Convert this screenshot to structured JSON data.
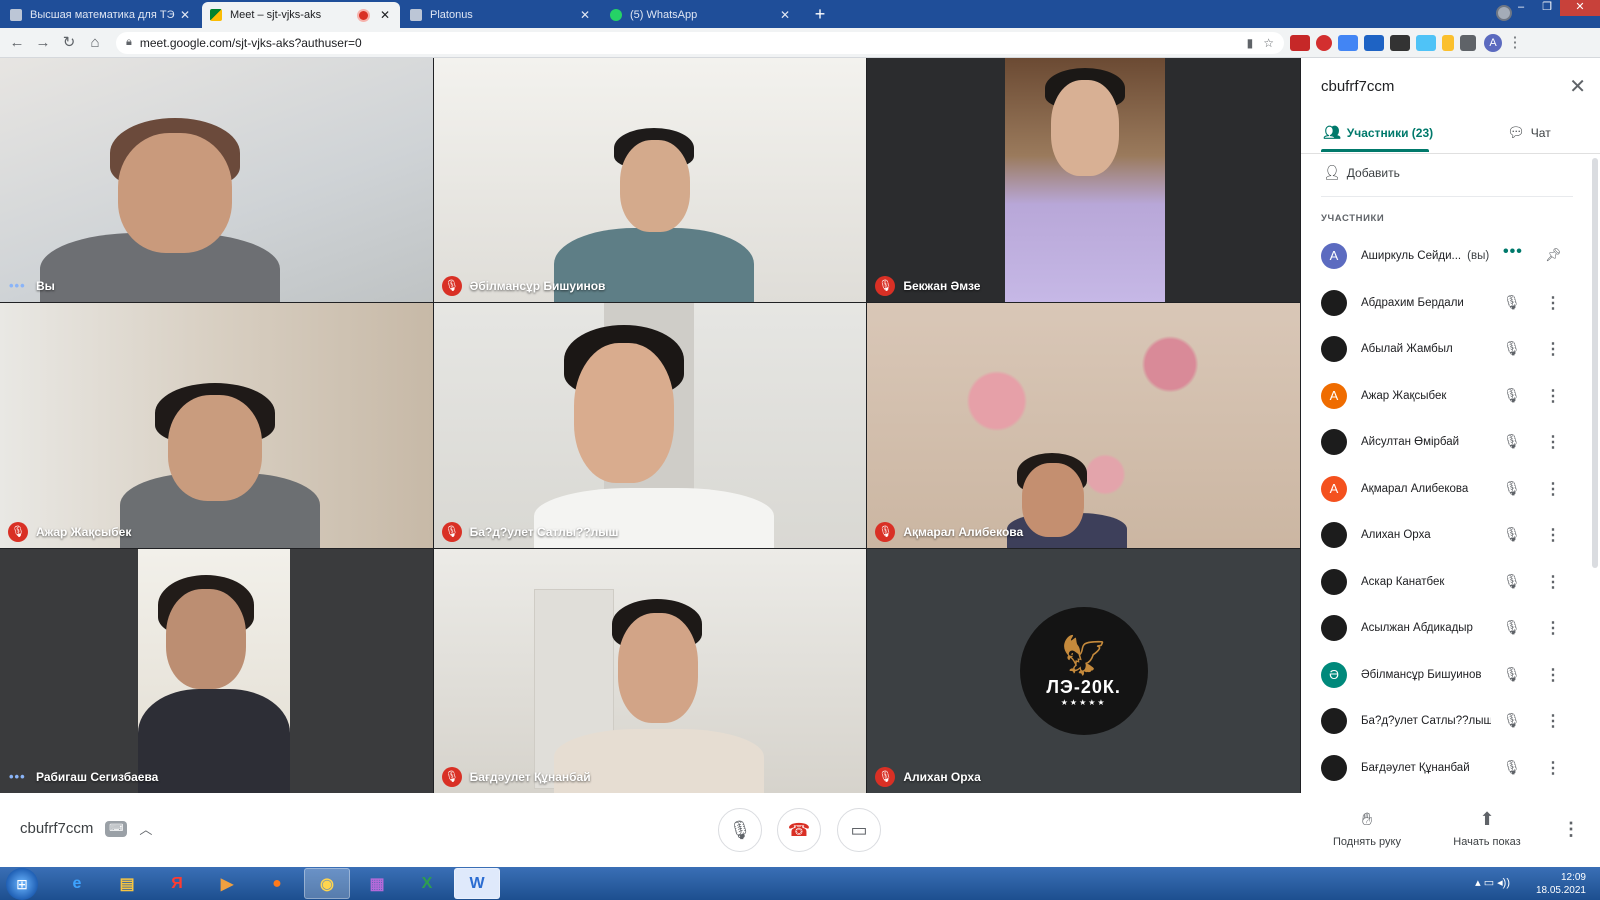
{
  "browser": {
    "tabs": [
      {
        "title": "Высшая математика для ТЭ",
        "active": false
      },
      {
        "title": "Meet – sjt-vjks-aks",
        "active": true,
        "recording": true
      },
      {
        "title": "Platonus",
        "active": false
      },
      {
        "title": "(5) WhatsApp",
        "active": false
      }
    ],
    "new_tab": "+",
    "url": "meet.google.com/sjt-vjks-aks?authuser=0",
    "profile_initial": "A"
  },
  "tiles": [
    {
      "name": "Вы",
      "indicator": "dots"
    },
    {
      "name": "Әбілмансұр Бишуинов",
      "indicator": "muted"
    },
    {
      "name": "Бекжан Әмзе",
      "indicator": "muted"
    },
    {
      "name": "Ажар Жақсыбек",
      "indicator": "muted"
    },
    {
      "name": "Ба?д?улет Сатлы??лыш",
      "indicator": "muted"
    },
    {
      "name": "Ақмарал Алибекова",
      "indicator": "muted"
    },
    {
      "name": "Рабигаш Сегизбаева",
      "indicator": "dots"
    },
    {
      "name": "Бағдәулет Құнанбай",
      "indicator": "muted"
    },
    {
      "name": "Алихан Орха",
      "indicator": "muted"
    }
  ],
  "logo": {
    "text": "ЛЭ-20К.",
    "stars": "★★★★★"
  },
  "panel": {
    "title": "cbufrf7ccm",
    "tab_people": "Участники (23)",
    "tab_chat": "Чат",
    "add_label": "Добавить",
    "section_label": "Участники",
    "you_suffix": "(вы)",
    "participants": [
      {
        "name": "Аширкуль Сейди...",
        "avatar": "A",
        "color": "#5c6bc0",
        "you": true
      },
      {
        "name": "Абдрахим Бердали",
        "avatar": "",
        "color": "#1c1c1c"
      },
      {
        "name": "Абылай Жамбыл",
        "avatar": "",
        "color": "#1c1c1c"
      },
      {
        "name": "Ажар Жақсыбек",
        "avatar": "A",
        "color": "#ef6c00"
      },
      {
        "name": "Айсултан Өмірбай",
        "avatar": "",
        "color": "#1c1c1c"
      },
      {
        "name": "Ақмарал Алибекова",
        "avatar": "A",
        "color": "#f4511e"
      },
      {
        "name": "Алихан Орха",
        "avatar": "",
        "color": "#1c1c1c"
      },
      {
        "name": "Аскар Канатбек",
        "avatar": "",
        "color": "#1c1c1c"
      },
      {
        "name": "Асылжан Абдикадыр",
        "avatar": "",
        "color": "#1c1c1c"
      },
      {
        "name": "Әбілмансұр Бишуинов",
        "avatar": "Ә",
        "color": "#00897b"
      },
      {
        "name": "Ба?д?улет Сатлы??лыш",
        "avatar": "",
        "color": "#1c1c1c"
      },
      {
        "name": "Бағдәулет Құнанбай",
        "avatar": "",
        "color": "#1c1c1c"
      }
    ]
  },
  "bottom": {
    "meeting_code": "cbufrf7ccm",
    "raise_hand": "Поднять руку",
    "present": "Начать показ"
  },
  "taskbar": {
    "time": "12:09",
    "date": "18.05.2021"
  },
  "colors": {
    "accent": "#00796b",
    "mute": "#d93025",
    "chrome_blue": "#1f4e99"
  }
}
